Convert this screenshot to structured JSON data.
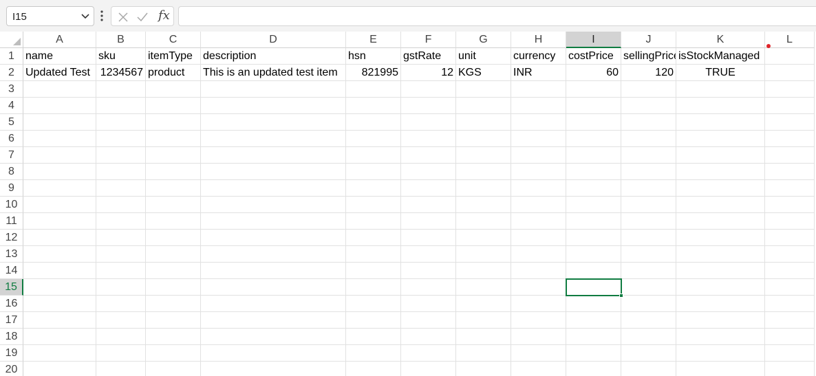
{
  "name_box": {
    "value": "I15"
  },
  "formula_bar": {
    "fx": "fx",
    "content": ""
  },
  "columns": [
    "A",
    "B",
    "C",
    "D",
    "E",
    "F",
    "G",
    "H",
    "I",
    "J",
    "K",
    "L"
  ],
  "active_column": "I",
  "row_numbers": [
    "1",
    "2",
    "3",
    "4",
    "5",
    "6",
    "7",
    "8",
    "9",
    "10",
    "11",
    "12",
    "13",
    "14",
    "15",
    "16",
    "17",
    "18",
    "19",
    "20"
  ],
  "active_row": "15",
  "active_cell": "I15",
  "sheet": {
    "header_row": [
      "name",
      "sku",
      "itemType",
      "description",
      "hsn",
      "gstRate",
      "unit",
      "currency",
      "costPrice",
      "sellingPrice",
      "isStockManaged"
    ],
    "data_row": [
      "Updated Test",
      "1234567",
      "product",
      "This is an updated test item",
      "821995",
      "12",
      "KGS",
      "INR",
      "60",
      "120",
      "TRUE"
    ]
  },
  "icons": {
    "name_box_dropdown": "chevron-down-icon",
    "more": "vertical-dots-icon",
    "cancel": "close-icon",
    "enter": "check-icon",
    "function": "fx-icon",
    "comment_marker": "red-dot"
  }
}
